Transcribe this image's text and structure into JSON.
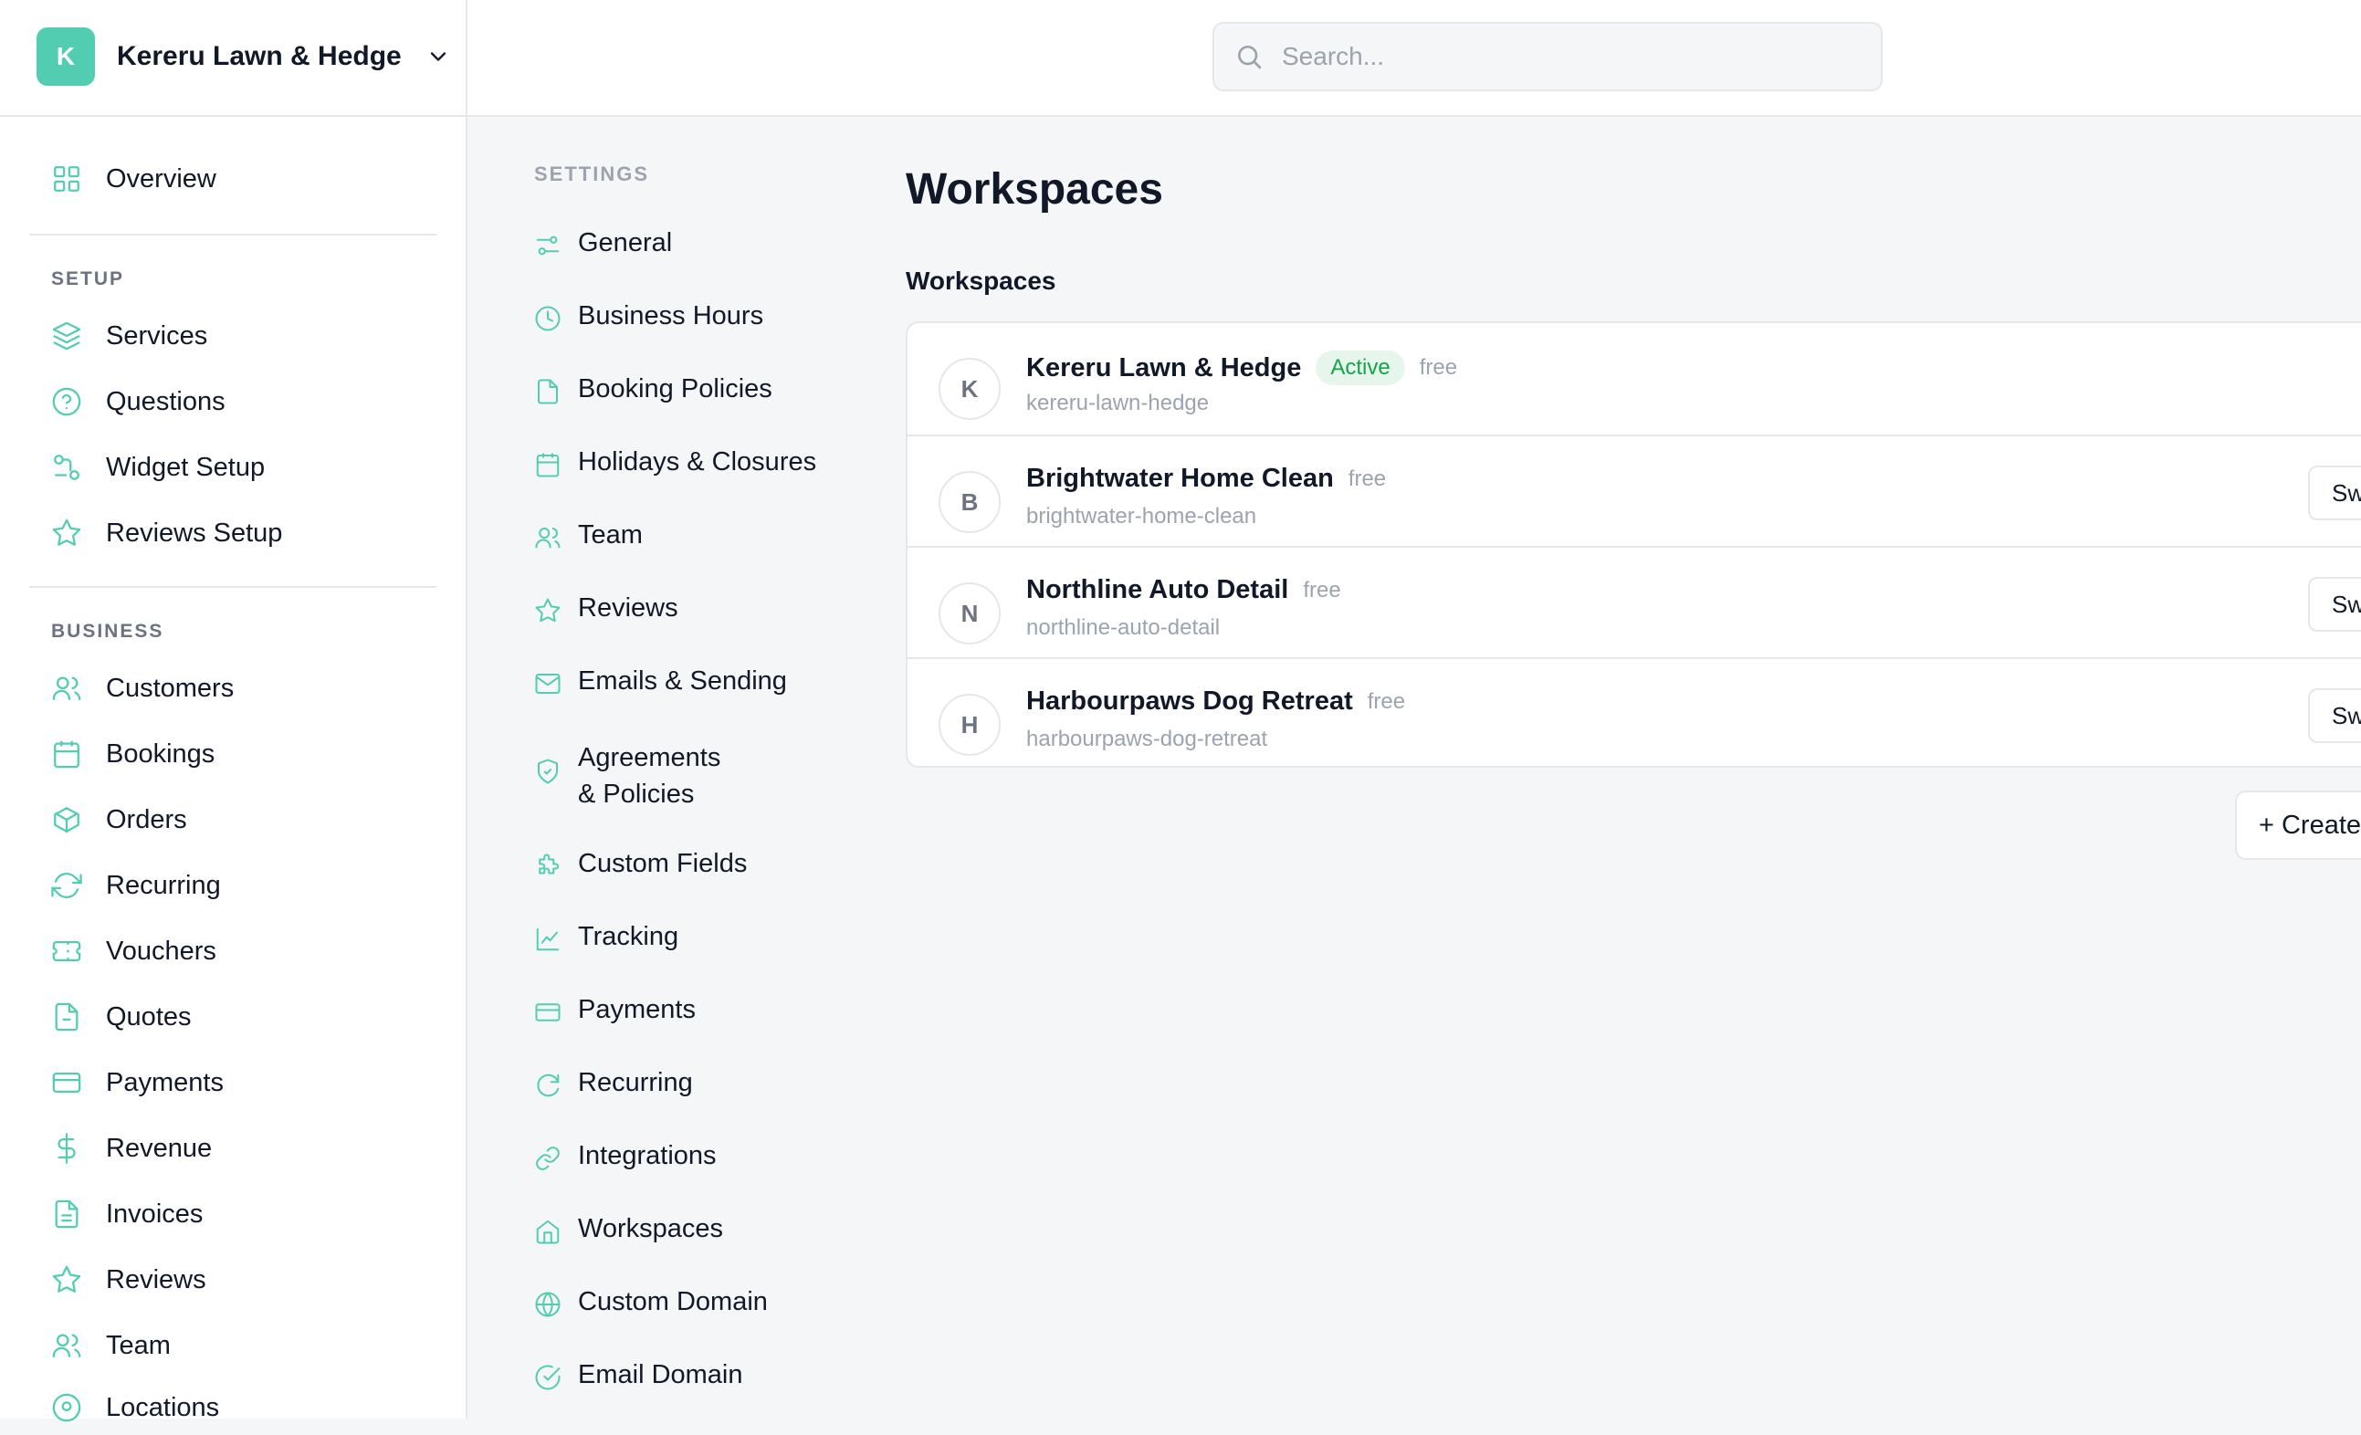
{
  "brand": {
    "initial": "K",
    "name": "Kereru Lawn & Hedge",
    "color": "#52cdb1"
  },
  "search": {
    "placeholder": "Search..."
  },
  "sidebar": {
    "overview": "Overview",
    "setup_label": "SETUP",
    "setup_items": [
      {
        "label": "Services",
        "icon": "layers-icon"
      },
      {
        "label": "Questions",
        "icon": "help-circle-icon"
      },
      {
        "label": "Widget Setup",
        "icon": "widget-icon"
      },
      {
        "label": "Reviews Setup",
        "icon": "star-icon"
      }
    ],
    "business_label": "BUSINESS",
    "business_items": [
      {
        "label": "Customers",
        "icon": "users-icon"
      },
      {
        "label": "Bookings",
        "icon": "calendar-icon"
      },
      {
        "label": "Orders",
        "icon": "box-icon"
      },
      {
        "label": "Recurring",
        "icon": "refresh-icon"
      },
      {
        "label": "Vouchers",
        "icon": "ticket-icon"
      },
      {
        "label": "Quotes",
        "icon": "file-icon"
      },
      {
        "label": "Payments",
        "icon": "credit-card-icon"
      },
      {
        "label": "Revenue",
        "icon": "dollar-icon"
      },
      {
        "label": "Invoices",
        "icon": "file-text-icon"
      },
      {
        "label": "Reviews",
        "icon": "star-icon"
      },
      {
        "label": "Team",
        "icon": "users-icon"
      },
      {
        "label": "Locations",
        "icon": "location-icon"
      }
    ]
  },
  "settings": {
    "label": "SETTINGS",
    "items": [
      {
        "label": "General",
        "icon": "sliders-icon"
      },
      {
        "label": "Business Hours",
        "icon": "clock-icon"
      },
      {
        "label": "Booking Policies",
        "icon": "file-icon"
      },
      {
        "label": "Holidays & Closures",
        "icon": "calendar-icon"
      },
      {
        "label": "Team",
        "icon": "users-icon"
      },
      {
        "label": "Reviews",
        "icon": "star-icon"
      },
      {
        "label": "Emails & Sending",
        "icon": "mail-icon"
      },
      {
        "label": "Agreements & Policies",
        "icon": "shield-check-icon"
      },
      {
        "label": "Custom Fields",
        "icon": "puzzle-icon"
      },
      {
        "label": "Tracking",
        "icon": "chart-line-icon"
      },
      {
        "label": "Payments",
        "icon": "credit-card-icon"
      },
      {
        "label": "Recurring",
        "icon": "rotate-icon"
      },
      {
        "label": "Integrations",
        "icon": "link-icon"
      },
      {
        "label": "Workspaces",
        "icon": "home-icon"
      },
      {
        "label": "Custom Domain",
        "icon": "globe-icon"
      },
      {
        "label": "Email Domain",
        "icon": "check-circle-icon"
      }
    ]
  },
  "main": {
    "title": "Workspaces",
    "section_title": "Workspaces",
    "workspaces": [
      {
        "initial": "K",
        "name": "Kereru Lawn & Hedge",
        "badge": "Active",
        "plan": "free",
        "slug": "kereru-lawn-hedge",
        "action": ""
      },
      {
        "initial": "B",
        "name": "Brightwater Home Clean",
        "badge": "",
        "plan": "free",
        "slug": "brightwater-home-clean",
        "action": "Sw"
      },
      {
        "initial": "N",
        "name": "Northline Auto Detail",
        "badge": "",
        "plan": "free",
        "slug": "northline-auto-detail",
        "action": "Sw"
      },
      {
        "initial": "H",
        "name": "Harbourpaws Dog Retreat",
        "badge": "",
        "plan": "free",
        "slug": "harbourpaws-dog-retreat",
        "action": "Sw"
      }
    ],
    "create_label": "+ Create"
  },
  "colors": {
    "accent": "#52cdb1",
    "active_badge_bg": "#e7f6ec",
    "active_badge_text": "#16a34a"
  }
}
